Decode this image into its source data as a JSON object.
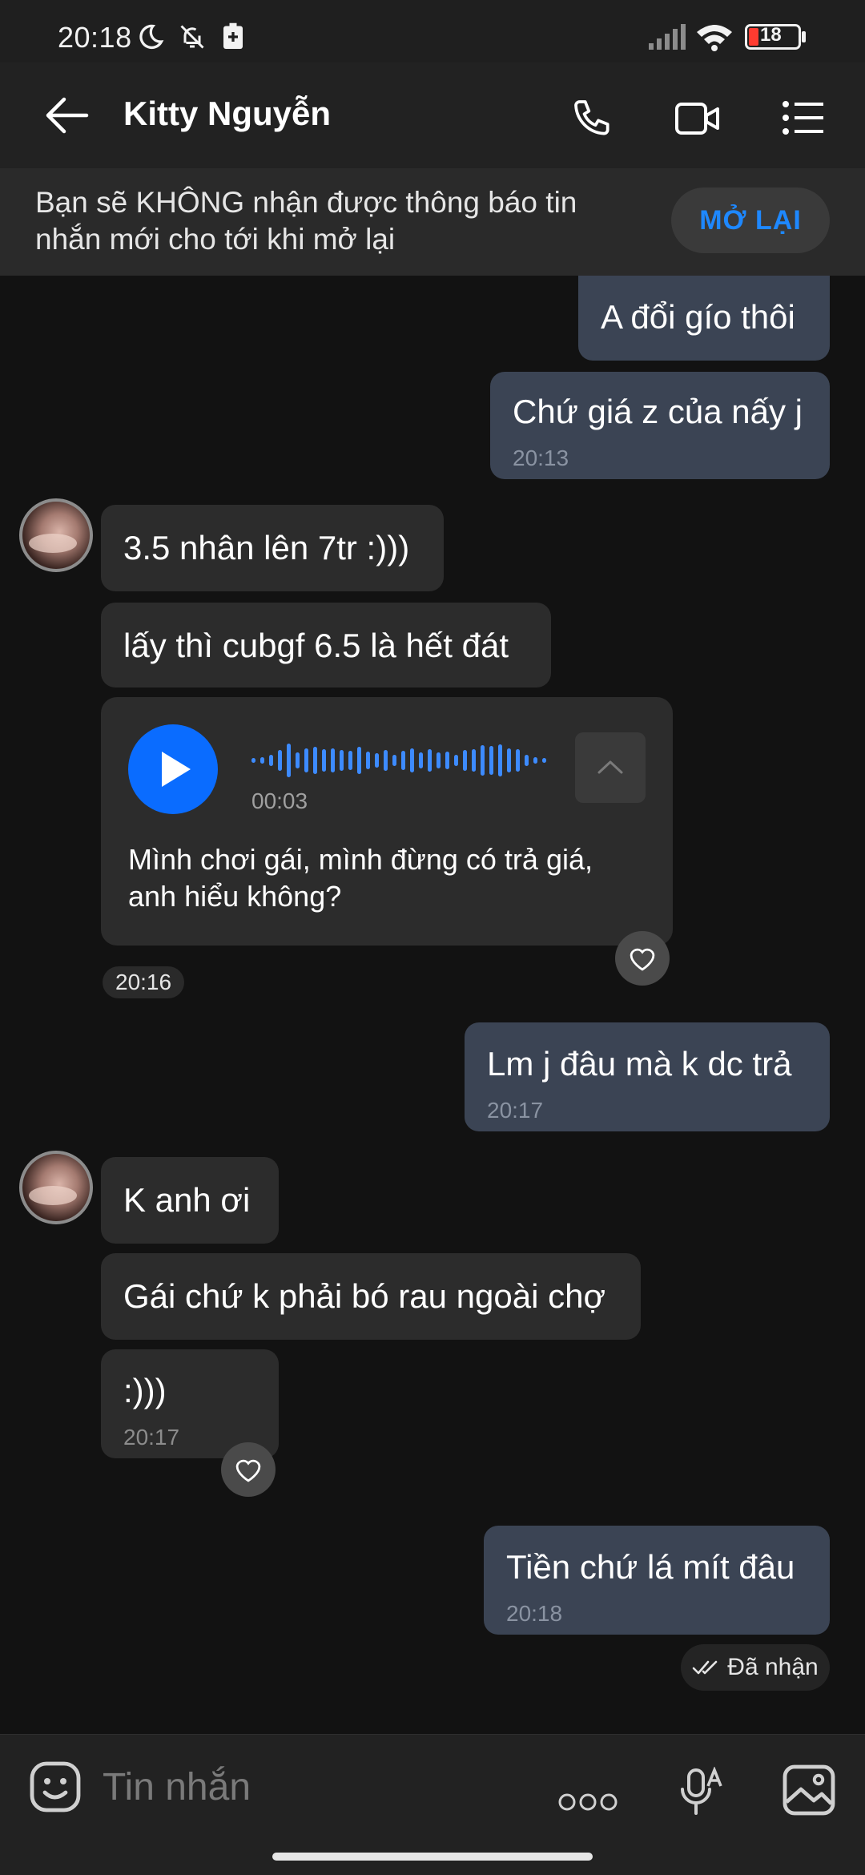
{
  "status_bar": {
    "time": "20:18",
    "battery": "18",
    "icons": [
      "moon-icon",
      "bell-off-icon",
      "battery-saver-icon",
      "signal-icon",
      "wifi-icon",
      "battery-icon"
    ]
  },
  "header": {
    "back_icon": "arrow-left-icon",
    "title": "Kitty Nguyễn",
    "actions": [
      "phone-icon",
      "video-call-icon",
      "menu-list-icon"
    ]
  },
  "banner": {
    "text": "Bạn sẽ KHÔNG nhận được thông báo tin nhắn mới cho tới khi mở lại",
    "button_label": "MỞ LẠI"
  },
  "messages": {
    "out1": {
      "text": "A đổi gío thôi"
    },
    "out2": {
      "text": "Chứ giá z của nấy j",
      "time": "20:13"
    },
    "in1": {
      "text": "3.5 nhân lên 7tr :)))"
    },
    "in2": {
      "text": "lấy thì cubgf 6.5 là hết đát"
    },
    "voice": {
      "duration": "00:03",
      "transcript": "Mình chơi gái, mình đừng có trả giá, anh hiểu không?",
      "time": "20:16"
    },
    "out3": {
      "text": "Lm j đâu mà k dc trả",
      "time": "20:17"
    },
    "in3": {
      "text": "K anh ơi"
    },
    "in4": {
      "text": "Gái chứ k phải bó rau ngoài chợ"
    },
    "in5": {
      "text": ":)))",
      "time": "20:17"
    },
    "out4": {
      "text": "Tiền chứ lá mít đâu",
      "time": "20:18"
    },
    "delivery_status": "Đã nhận"
  },
  "composer": {
    "placeholder": "Tin nhắn",
    "icons": [
      "sticker-icon",
      "more-options-icon",
      "microphone-icon",
      "image-icon"
    ]
  },
  "colors": {
    "background": "#121212",
    "outgoing_bubble": "#3b4454",
    "incoming_bubble": "#2c2c2c",
    "accent": "#1e88ff",
    "voice_play": "#0a6cff"
  }
}
